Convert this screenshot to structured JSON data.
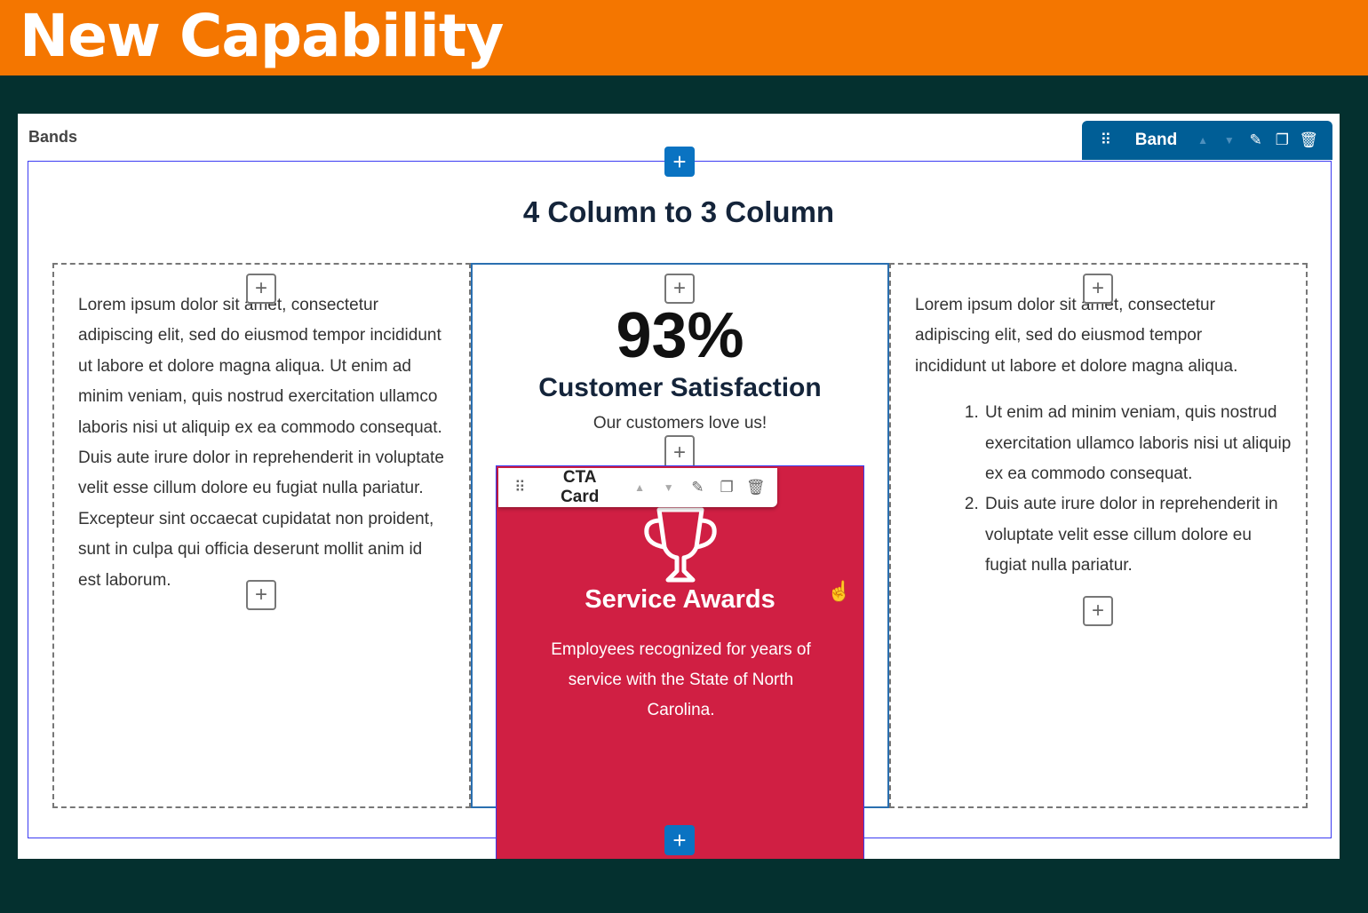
{
  "header": {
    "title": "New Capability"
  },
  "colors": {
    "header_bg": "#f47600",
    "page_bg": "#04302f",
    "band_toolbar": "#005e96",
    "cta_bg": "#d01f43",
    "add_button": "#0a73c2"
  },
  "panel": {
    "label": "Bands"
  },
  "band_toolbar": {
    "label": "Band",
    "icons": [
      "drag-handle-icon",
      "arrow-up-icon",
      "arrow-down-icon",
      "pencil-icon",
      "copy-icon",
      "trash-icon"
    ]
  },
  "band": {
    "title": "4 Column to 3 Column"
  },
  "left_column": {
    "text": "Lorem ipsum dolor sit amet, consectetur adipiscing elit, sed do eiusmod tempor incididunt ut labore et dolore magna aliqua. Ut enim ad minim veniam, quis nostrud exercitation ullamco laboris nisi ut aliquip ex ea commodo consequat. Duis aute irure dolor in reprehenderit in voluptate velit esse cillum dolore eu fugiat nulla pariatur. Excepteur sint occaecat cupidatat non proident, sunt in culpa qui officia deserunt mollit anim id est laborum."
  },
  "center_column": {
    "stat": "93%",
    "stat_label": "Customer Satisfaction",
    "stat_sub": "Our customers love us!"
  },
  "cta_card": {
    "toolbar_label": "CTA Card",
    "icon": "trophy-icon",
    "title": "Service Awards",
    "body": "Employees recognized for years of service with the State of North Carolina."
  },
  "right_column": {
    "text": "Lorem ipsum dolor sit amet, consectetur adipiscing elit, sed do eiusmod tempor incididunt ut labore et dolore magna aliqua.",
    "list": [
      "Ut enim ad minim veniam, quis nostrud exercitation ullamco laboris nisi ut aliquip ex ea commodo consequat.",
      "Duis aute irure dolor in reprehenderit in voluptate velit esse cillum dolore eu fugiat nulla pariatur."
    ]
  }
}
